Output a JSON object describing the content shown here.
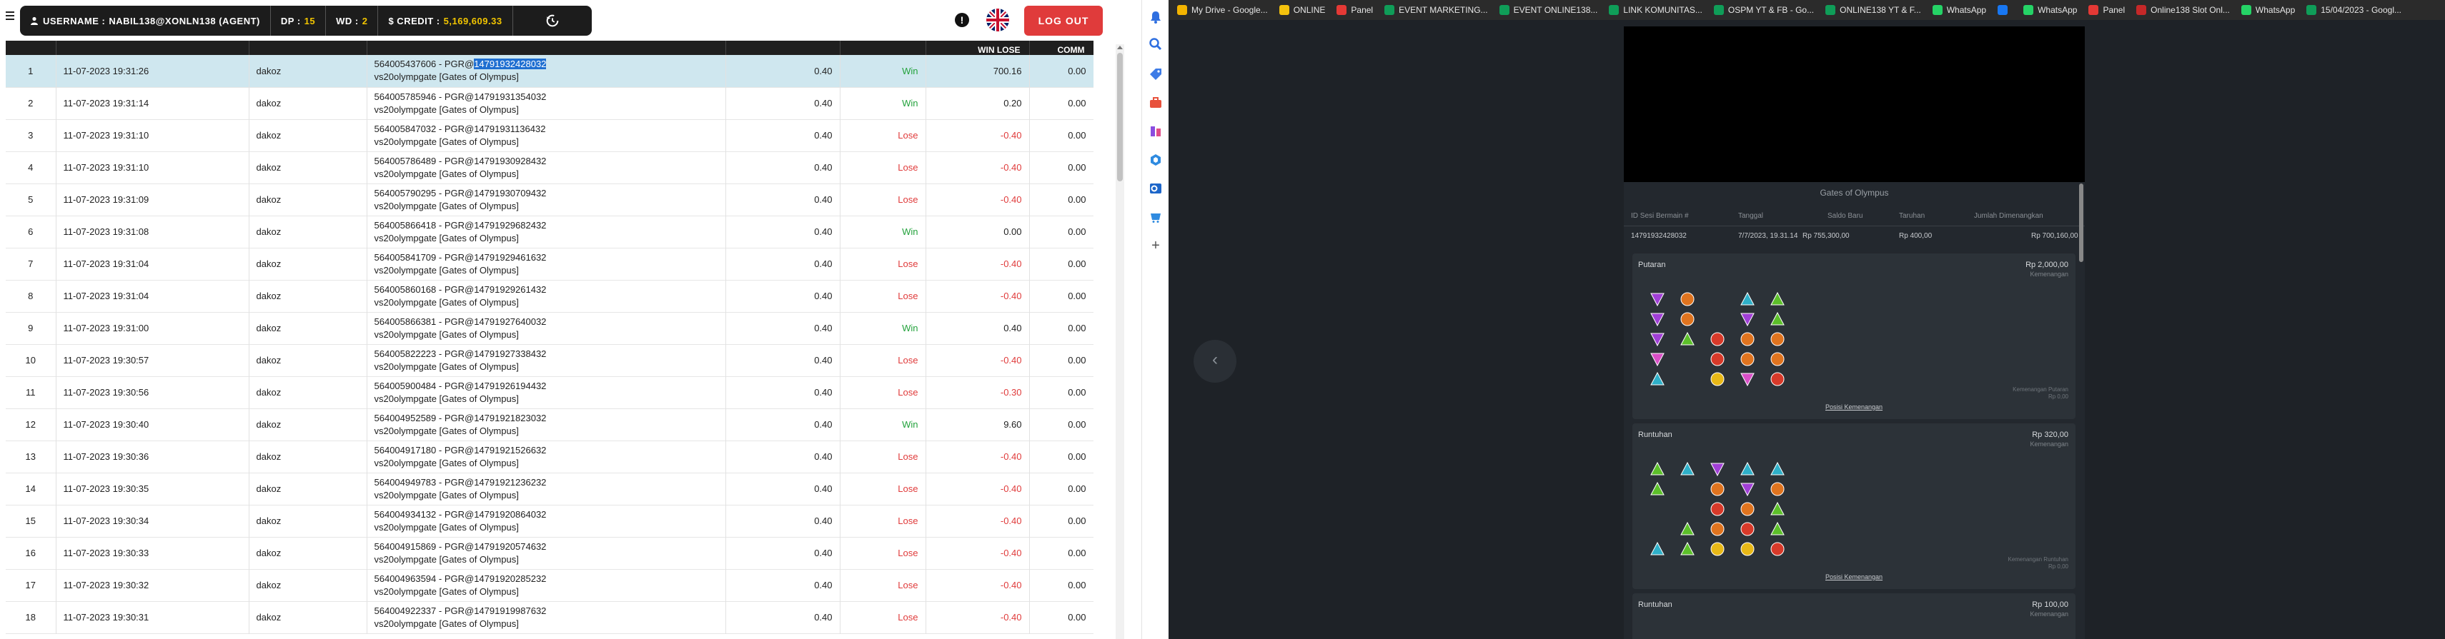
{
  "header": {
    "username_label": "USERNAME :",
    "username_value": "NABIL138@XONLN138 (AGENT)",
    "dp_label": "DP :",
    "dp_value": "15",
    "wd_label": "WD :",
    "wd_value": "2",
    "credit_label": "$ CREDIT :",
    "credit_value": "5,169,609.33",
    "logout_label": "LOG OUT",
    "accent_color": "#f2c500",
    "logout_color": "#e03b3b"
  },
  "table": {
    "columns": [
      "",
      "",
      "",
      "",
      "",
      "",
      "WIN LOSE",
      "COMM"
    ],
    "rows": [
      {
        "no": "1",
        "date": "11-07-2023 19:31:26",
        "user": "dakoz",
        "desc_pre": "564005437606 - PGR@",
        "desc_id": "14791932428032",
        "desc_game": "vs20olympgate [Gates of Olympus]",
        "bet": "0.40",
        "result": "Win",
        "winlose": "700.16",
        "comm": "0.00",
        "selected": true
      },
      {
        "no": "2",
        "date": "11-07-2023 19:31:14",
        "user": "dakoz",
        "desc_pre": "564005785946 - PGR@",
        "desc_id": "14791931354032",
        "desc_game": "vs20olympgate [Gates of Olympus]",
        "bet": "0.40",
        "result": "Win",
        "winlose": "0.20",
        "comm": "0.00"
      },
      {
        "no": "3",
        "date": "11-07-2023 19:31:10",
        "user": "dakoz",
        "desc_pre": "564005847032 - PGR@",
        "desc_id": "14791931136432",
        "desc_game": "vs20olympgate [Gates of Olympus]",
        "bet": "0.40",
        "result": "Lose",
        "winlose": "-0.40",
        "comm": "0.00"
      },
      {
        "no": "4",
        "date": "11-07-2023 19:31:10",
        "user": "dakoz",
        "desc_pre": "564005786489 - PGR@",
        "desc_id": "14791930928432",
        "desc_game": "vs20olympgate [Gates of Olympus]",
        "bet": "0.40",
        "result": "Lose",
        "winlose": "-0.40",
        "comm": "0.00"
      },
      {
        "no": "5",
        "date": "11-07-2023 19:31:09",
        "user": "dakoz",
        "desc_pre": "564005790295 - PGR@",
        "desc_id": "14791930709432",
        "desc_game": "vs20olympgate [Gates of Olympus]",
        "bet": "0.40",
        "result": "Lose",
        "winlose": "-0.40",
        "comm": "0.00"
      },
      {
        "no": "6",
        "date": "11-07-2023 19:31:08",
        "user": "dakoz",
        "desc_pre": "564005866418 - PGR@",
        "desc_id": "14791929682432",
        "desc_game": "vs20olympgate [Gates of Olympus]",
        "bet": "0.40",
        "result": "Win",
        "winlose": "0.00",
        "comm": "0.00"
      },
      {
        "no": "7",
        "date": "11-07-2023 19:31:04",
        "user": "dakoz",
        "desc_pre": "564005841709 - PGR@",
        "desc_id": "14791929461632",
        "desc_game": "vs20olympgate [Gates of Olympus]",
        "bet": "0.40",
        "result": "Lose",
        "winlose": "-0.40",
        "comm": "0.00"
      },
      {
        "no": "8",
        "date": "11-07-2023 19:31:04",
        "user": "dakoz",
        "desc_pre": "564005860168 - PGR@",
        "desc_id": "14791929261432",
        "desc_game": "vs20olympgate [Gates of Olympus]",
        "bet": "0.40",
        "result": "Lose",
        "winlose": "-0.40",
        "comm": "0.00"
      },
      {
        "no": "9",
        "date": "11-07-2023 19:31:00",
        "user": "dakoz",
        "desc_pre": "564005866381 - PGR@",
        "desc_id": "14791927640032",
        "desc_game": "vs20olympgate [Gates of Olympus]",
        "bet": "0.40",
        "result": "Win",
        "winlose": "0.40",
        "comm": "0.00"
      },
      {
        "no": "10",
        "date": "11-07-2023 19:30:57",
        "user": "dakoz",
        "desc_pre": "564005822223 - PGR@",
        "desc_id": "14791927338432",
        "desc_game": "vs20olympgate [Gates of Olympus]",
        "bet": "0.40",
        "result": "Lose",
        "winlose": "-0.40",
        "comm": "0.00"
      },
      {
        "no": "11",
        "date": "11-07-2023 19:30:56",
        "user": "dakoz",
        "desc_pre": "564005900484 - PGR@",
        "desc_id": "14791926194432",
        "desc_game": "vs20olympgate [Gates of Olympus]",
        "bet": "0.40",
        "result": "Lose",
        "winlose": "-0.30",
        "comm": "0.00"
      },
      {
        "no": "12",
        "date": "11-07-2023 19:30:40",
        "user": "dakoz",
        "desc_pre": "564004952589 - PGR@",
        "desc_id": "14791921823032",
        "desc_game": "vs20olympgate [Gates of Olympus]",
        "bet": "0.40",
        "result": "Win",
        "winlose": "9.60",
        "comm": "0.00"
      },
      {
        "no": "13",
        "date": "11-07-2023 19:30:36",
        "user": "dakoz",
        "desc_pre": "564004917180 - PGR@",
        "desc_id": "14791921526632",
        "desc_game": "vs20olympgate [Gates of Olympus]",
        "bet": "0.40",
        "result": "Lose",
        "winlose": "-0.40",
        "comm": "0.00"
      },
      {
        "no": "14",
        "date": "11-07-2023 19:30:35",
        "user": "dakoz",
        "desc_pre": "564004949783 - PGR@",
        "desc_id": "14791921236232",
        "desc_game": "vs20olympgate [Gates of Olympus]",
        "bet": "0.40",
        "result": "Lose",
        "winlose": "-0.40",
        "comm": "0.00"
      },
      {
        "no": "15",
        "date": "11-07-2023 19:30:34",
        "user": "dakoz",
        "desc_pre": "564004934132 - PGR@",
        "desc_id": "14791920864032",
        "desc_game": "vs20olympgate [Gates of Olympus]",
        "bet": "0.40",
        "result": "Lose",
        "winlose": "-0.40",
        "comm": "0.00"
      },
      {
        "no": "16",
        "date": "11-07-2023 19:30:33",
        "user": "dakoz",
        "desc_pre": "564004915869 - PGR@",
        "desc_id": "14791920574632",
        "desc_game": "vs20olympgate [Gates of Olympus]",
        "bet": "0.40",
        "result": "Lose",
        "winlose": "-0.40",
        "comm": "0.00"
      },
      {
        "no": "17",
        "date": "11-07-2023 19:30:32",
        "user": "dakoz",
        "desc_pre": "564004963594 - PGR@",
        "desc_id": "14791920285232",
        "desc_game": "vs20olympgate [Gates of Olympus]",
        "bet": "0.40",
        "result": "Lose",
        "winlose": "-0.40",
        "comm": "0.00"
      },
      {
        "no": "18",
        "date": "11-07-2023 19:30:31",
        "user": "dakoz",
        "desc_pre": "564004922337 - PGR@",
        "desc_id": "14791919987632",
        "desc_game": "vs20olympgate [Gates of Olympus]",
        "bet": "0.40",
        "result": "Lose",
        "winlose": "-0.40",
        "comm": "0.00"
      }
    ]
  },
  "bookmarks": [
    {
      "label": "My Drive - Google...",
      "icon": "drive-icon",
      "color": "#f4b400"
    },
    {
      "label": "ONLINE",
      "icon": "doc-icon",
      "color": "#f4c20d"
    },
    {
      "label": "Panel",
      "icon": "panel-icon",
      "color": "#e53935"
    },
    {
      "label": "EVENT MARKETING...",
      "icon": "sheets-icon",
      "color": "#0f9d58"
    },
    {
      "label": "EVENT ONLINE138...",
      "icon": "sheets-icon",
      "color": "#0f9d58"
    },
    {
      "label": "LINK KOMUNITAS...",
      "icon": "sheets-icon",
      "color": "#0f9d58"
    },
    {
      "label": "OSPM YT & FB - Go...",
      "icon": "sheets-icon",
      "color": "#0f9d58"
    },
    {
      "label": "ONLINE138 YT & F...",
      "icon": "sheets-icon",
      "color": "#0f9d58"
    },
    {
      "label": "WhatsApp",
      "icon": "whatsapp-icon",
      "color": "#25d366"
    },
    {
      "label": "",
      "icon": "facebook-icon",
      "color": "#1877f2"
    },
    {
      "label": "WhatsApp",
      "icon": "whatsapp-icon",
      "color": "#25d366"
    },
    {
      "label": "Panel",
      "icon": "panel-icon",
      "color": "#e53935"
    },
    {
      "label": "Online138 Slot Onl...",
      "icon": "slot-icon",
      "color": "#c62828"
    },
    {
      "label": "WhatsApp",
      "icon": "whatsapp-icon",
      "color": "#25d366"
    },
    {
      "label": "15/04/2023 - Googl...",
      "icon": "sheets-icon",
      "color": "#0f9d58"
    }
  ],
  "game": {
    "title": "Gates of Olympus",
    "headers": [
      "ID Sesi Bermain #",
      "Tanggal",
      "Saldo Baru",
      "Taruhan",
      "Jumlah Dimenangkan"
    ],
    "row": [
      "14791932428032",
      "7/7/2023, 19.31.14",
      "Rp 755,300,00",
      "Rp 400,00",
      "Rp 700,160,00"
    ],
    "spins": [
      {
        "label": "Putaran",
        "amount": "Rp 2,000,00",
        "sub": "Kemenangan",
        "win_sub": "Kemenangan Putaran",
        "win_sub2": "Rp 0,00",
        "link": "Posisi Kemenangan"
      },
      {
        "label": "Runtuhan",
        "amount": "Rp 320,00",
        "sub": "Kemenangan",
        "win_sub": "Kemenangan Runtuhan",
        "win_sub2": "Rp 0,00",
        "link": "Posisi Kemenangan"
      },
      {
        "label": "Runtuhan",
        "amount": "Rp 100,00",
        "sub": "Kemenangan"
      }
    ],
    "symbol_grid_1": [
      [
        "purple",
        "orange",
        "",
        "teal",
        "green"
      ],
      [
        "purple",
        "orange",
        "",
        "purple",
        "green"
      ],
      [
        "purple",
        "green",
        "red",
        "orange",
        "orange"
      ],
      [
        "pink",
        "",
        "red",
        "orange",
        "orange"
      ],
      [
        "teal",
        "",
        "yellow",
        "pink",
        "red"
      ]
    ],
    "symbol_grid_2": [
      [
        "green",
        "teal",
        "purple",
        "teal",
        "teal"
      ],
      [
        "green",
        "",
        "orange",
        "purple",
        "orange"
      ],
      [
        "",
        "",
        "red",
        "orange",
        "green"
      ],
      [
        "",
        "green",
        "orange",
        "red",
        "green"
      ],
      [
        "teal",
        "green",
        "yellow",
        "yellow",
        "red"
      ]
    ]
  }
}
